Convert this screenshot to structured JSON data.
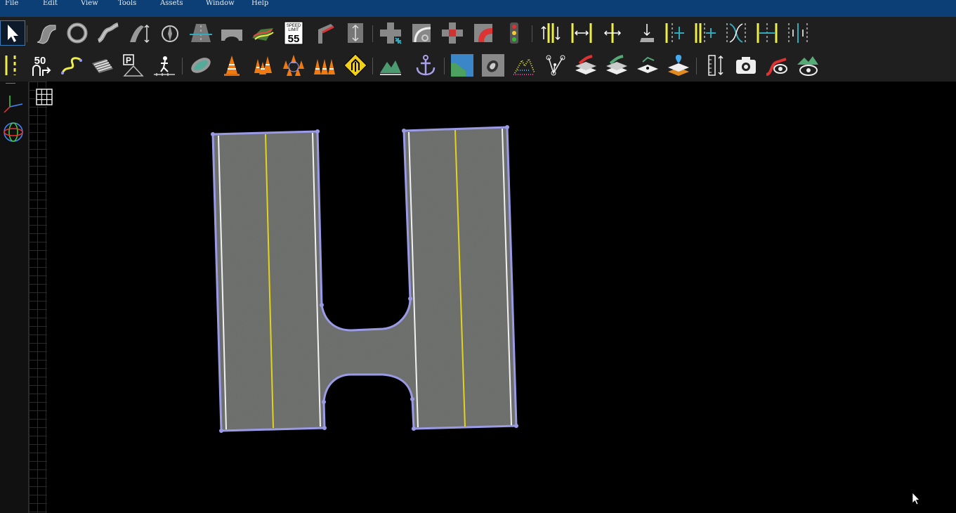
{
  "menu": {
    "file": "File",
    "edit": "Edit",
    "view": "View",
    "tools": "Tools",
    "assets": "Assets",
    "window": "Window",
    "help": "Help"
  },
  "toolbar": {
    "speed_sign_top": "SPEED",
    "speed_sign_mid": "LIMIT",
    "speed_sign_value": "55",
    "speed_marker_value": "50",
    "parking_letter": "P"
  },
  "colors": {
    "menubar": "#0b3f75",
    "toolbar": "#1f1f1f",
    "road_surface": "#6b6d6b",
    "road_outline": "#9a9ae6",
    "center_line": "#e4d21c",
    "edge_line": "#f2f2f2"
  },
  "icons": [
    "select-arrow-icon",
    "road-curve-icon",
    "roundabout-icon",
    "spline-road-icon",
    "road-lanes-icon",
    "compass-road-icon",
    "highway-icon",
    "bridge-icon",
    "terrain-texture-icon",
    "speed-limit-sign-icon",
    "road-branch-icon",
    "lane-merge-icon",
    "intersection-icon",
    "turn-intersection-icon",
    "crossroad-icon",
    "turn-lane-icon",
    "traffic-light-icon",
    "lane-width-icon",
    "lane-stretch-icon",
    "lane-center-icon",
    "lane-lift-icon",
    "lane-add-icon",
    "lane-insert-icon",
    "lane-split-icon",
    "lane-cross-icon",
    "lane-marking-icon",
    "lane-marking-double-icon",
    "speed-marker-icon",
    "curve-path-icon",
    "crosswalk-stripes-icon",
    "parking-icon",
    "pedestrian-icon",
    "island-icon",
    "cone-icon",
    "cone-group-icon",
    "cone-ring-icon",
    "cone-row-icon",
    "warning-sign-icon",
    "terrain-icon",
    "anchor-icon",
    "map-satellite-icon",
    "map-height-icon",
    "point-cloud-icon",
    "node-graph-icon",
    "layer-road-icon",
    "layer-curve-icon",
    "layer-point-icon",
    "layer-pin-icon",
    "measure-icon",
    "camera-icon",
    "road-view-icon",
    "terrain-view-icon",
    "axis-gizmo-icon",
    "orbit-gizmo-icon",
    "grid-toggle-icon",
    "mouse-cursor-icon"
  ]
}
